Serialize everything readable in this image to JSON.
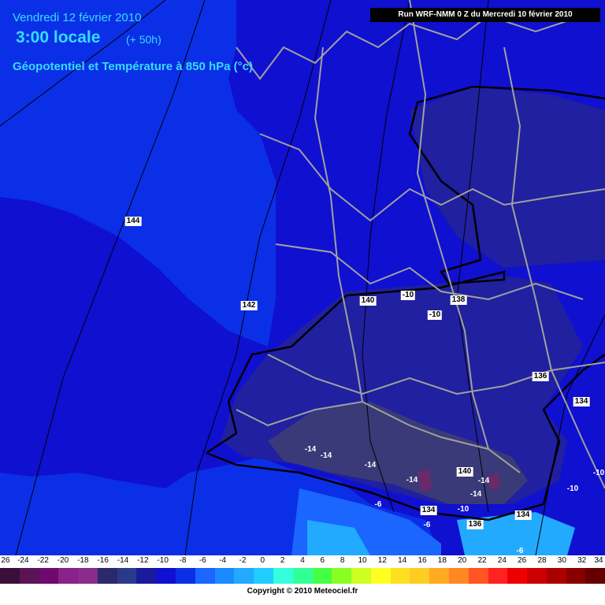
{
  "header": {
    "date": "Vendredi 12 février 2010",
    "time": "3:00 locale",
    "lead": "(+ 50h)",
    "parameter": "Géopotentiel et Température à 850 hPa (°c)",
    "run": "Run WRF-NMM 0 Z du Mercredi 10 février 2010"
  },
  "colors": {
    "ocean": "#0b2fe6",
    "land_cold": "#1010d0",
    "land_colder": "#2020a0",
    "mountain": "#3a3a78",
    "peak": "#6a2a6a",
    "sea_warm": "#1a66ff",
    "sea_warmer": "#22aaff",
    "borders": "#a0a0a0"
  },
  "map_labels": [
    {
      "text": "144",
      "type": "geopotential"
    },
    {
      "text": "142",
      "type": "geopotential"
    },
    {
      "text": "140",
      "type": "geopotential"
    },
    {
      "text": "-10",
      "type": "temperature"
    },
    {
      "text": "138",
      "type": "geopotential"
    },
    {
      "text": "-10",
      "type": "temperature"
    },
    {
      "text": "136",
      "type": "geopotential"
    },
    {
      "text": "134",
      "type": "geopotential"
    },
    {
      "text": "-14",
      "type": "temperature"
    },
    {
      "text": "-14",
      "type": "temperature"
    },
    {
      "text": "-14",
      "type": "temperature"
    },
    {
      "text": "-14",
      "type": "temperature"
    },
    {
      "text": "140",
      "type": "geopotential"
    },
    {
      "text": "-14",
      "type": "temperature"
    },
    {
      "text": "-14",
      "type": "temperature"
    },
    {
      "text": "-6",
      "type": "temperature"
    },
    {
      "text": "134",
      "type": "geopotential"
    },
    {
      "text": "-6",
      "type": "temperature"
    },
    {
      "text": "-10",
      "type": "temperature"
    },
    {
      "text": "136",
      "type": "geopotential"
    },
    {
      "text": "134",
      "type": "geopotential"
    },
    {
      "text": "-10",
      "type": "temperature"
    },
    {
      "text": "-10",
      "type": "temperature"
    },
    {
      "text": "-6",
      "type": "temperature"
    }
  ],
  "scale": {
    "ticks": [
      "26",
      "-24",
      "-22",
      "-20",
      "-18",
      "-16",
      "-14",
      "-12",
      "-10",
      "-8",
      "-6",
      "-4",
      "-2",
      "0",
      "2",
      "4",
      "6",
      "8",
      "10",
      "12",
      "14",
      "16",
      "18",
      "20",
      "22",
      "24",
      "26",
      "28",
      "30",
      "32",
      "34"
    ],
    "colors": [
      "#3a0f3a",
      "#5a1456",
      "#6e0a6e",
      "#8a208a",
      "#8a2c8a",
      "#2a2a6a",
      "#2a3a8a",
      "#1a1a9a",
      "#1010d0",
      "#0b2fe6",
      "#1a66ff",
      "#1a8aff",
      "#22aaff",
      "#22ccff",
      "#33ffdd",
      "#33ff99",
      "#44ff44",
      "#88ff22",
      "#ccff22",
      "#ffff22",
      "#ffe020",
      "#ffcc22",
      "#ffaa22",
      "#ff8822",
      "#ff5522",
      "#ff2222",
      "#ee0000",
      "#cc0000",
      "#aa0000",
      "#880000",
      "#660000"
    ],
    "copyright": "Copyright © 2010 Meteociel.fr"
  }
}
